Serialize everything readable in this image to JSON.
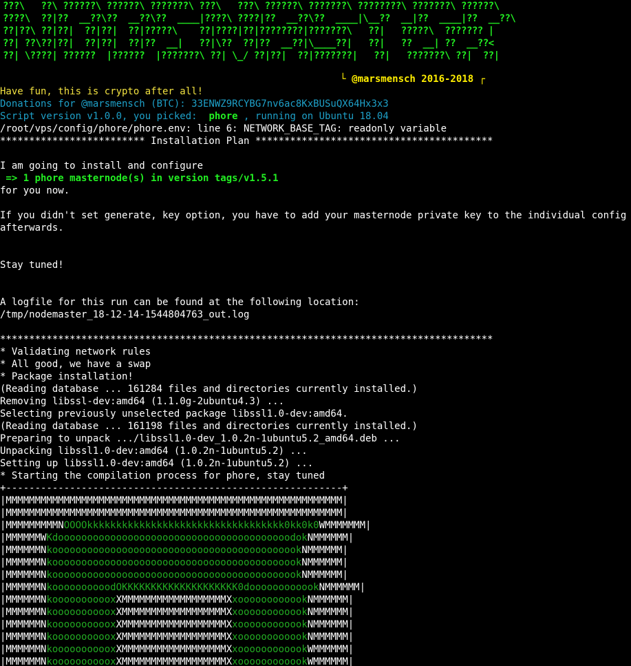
{
  "banner": {
    "lines": [
      "???\\   ??\\ ??????\\ ??????\\ ???????\\ ???\\   ???\\ ??????\\ ???????\\ ????????\\ ???????\\ ??????\\",
      "????\\  ??|??  __??\\??  __??\\??  ____|????\\ ????|??  __??\\??  ____|\\__??  __|??  ____|??  __??\\",
      "??|??\\ ??|??|  ??|??|  ??|?????\\    ??|????|??|????????|???????\\   ??|   ?????\\  ??????? |",
      "??| ??\\??|??|  ??|??|  ??|??  __|   ??|\\??  ??|??  __??|\\____??|   ??|   ??  __| ??  __??<",
      "??| \\????| ??????  |??????  |???????\\ ??| \\_/ ??|??|  ??|???????|   ??|   ???????\\ ??|  ??|"
    ],
    "credit": "└ @marsmensch 2016-2018 ┌"
  },
  "log": {
    "fun_line": "Have fun, this is crypto after all!",
    "donations": "Donations for @marsmensch (BTC): 33ENWZ9RCYBG7nv6ac8KxBUSuQX64Hx3x3",
    "script_prefix": "Script version v1.0.0, you picked: ",
    "script_coin": " phore ",
    "script_suffix": ", running on Ubuntu 18.04",
    "env_error": "/root/vps/config/phore/phore.env: line 6: NETWORK_BASE_TAG: readonly variable",
    "plan_header": "************************* Installation Plan *****************************************",
    "install_intro": "I am going to install and configure",
    "install_target": " => 1 phore masternode(s) in version tags/v1.5.1",
    "for_you": "for you now.",
    "genkey_note": "If you didn't set generate, key option, you have to add your masternode private key to the individual config files",
    "afterwards": "afterwards.",
    "stay_tuned": "Stay tuned!",
    "logfile_intro": "A logfile for this run can be found at the following location:",
    "logfile_path": "/tmp/nodemaster_18-12-14-1544804763_out.log",
    "stars": "*************************************************************************************",
    "validating": "* Validating network rules",
    "swap": "* All good, we have a swap",
    "pkg_install": "* Package installation!",
    "reading_db_1": "(Reading database ... 161284 files and directories currently installed.)",
    "removing": "Removing libssl-dev:amd64 (1.1.0g-2ubuntu4.3) ...",
    "selecting": "Selecting previously unselected package libssl1.0-dev:amd64.",
    "reading_db_2": "(Reading database ... 161198 files and directories currently installed.)",
    "preparing": "Preparing to unpack .../libssl1.0-dev_1.0.2n-1ubuntu5.2_amd64.deb ...",
    "unpacking": "Unpacking libssl1.0-dev:amd64 (1.0.2n-1ubuntu5.2) ...",
    "setting_up": "Setting up libssl1.0-dev:amd64 (1.0.2n-1ubuntu5.2) ...",
    "compilation": "* Starting the compilation process for phore, stay tuned",
    "box_top": "+----------------------------------------------------------+"
  },
  "logo_rows": [
    {
      "l": "|MMMMMMMMMMMMMMMMMMMMMMMMMMMMMMMMMMMMMMMMMMMMMMMMMMMMMMMMMM|",
      "g": "",
      "r": ""
    },
    {
      "l": "|MMMMMMMMMMMMMMMMMMMMMMMMMMMMMMMMMMMMMMMMMMMMMMMMMMMMMMMMMM|",
      "g": "",
      "r": ""
    },
    {
      "l": "|MMMMMMMMMN",
      "g": "OOOOkkkkkkkkkkkkkkkkkkkkkkkkkkkkkkkkkk0kk0k0",
      "r": "WMMMMMMM|"
    },
    {
      "l": "|MMMMMMW",
      "g": "Kdoooooooooooooooooooooooooooooooooooooooodok",
      "r": "NMMMMMM|"
    },
    {
      "l": "|MMMMMMN",
      "g": "kooooooooooooooooooooooooooooooooooooooooook",
      "r": "NMMMMMM|"
    },
    {
      "l": "|MMMMMMN",
      "g": "kooooooooooooooooooooooooooooooooooooooooook",
      "r": "NMMMMMM|"
    },
    {
      "l": "|MMMMMMN",
      "g": "kooooooooooooooooooooooooooooooooooooooooook",
      "r": "NMMMMMM|"
    },
    {
      "l": "|MMMMMMN",
      "g": "koooooooooodOKKKKKKKKKKKKKKKKKKKK0doooooooooook",
      "r": "NMMMMMM|"
    },
    {
      "l": "|MMMMMMN",
      "g": "koooooooooox",
      "r": "XMMMMMMMMMMMMMMMMMMX",
      "g2": "xoooooooooook",
      "r2": "NMMMMMM|"
    },
    {
      "l": "|MMMMMMN",
      "g": "koooooooooox",
      "r": "XMMMMMMMMMMMMMMMMMMX",
      "g2": "xoooooooooook",
      "r2": "NMMMMMM|"
    },
    {
      "l": "|MMMMMMN",
      "g": "koooooooooox",
      "r": "XMMMMMMMMMMMMMMMMMMX",
      "g2": "xoooooooooook",
      "r2": "NMMMMMM|"
    },
    {
      "l": "|MMMMMMN",
      "g": "koooooooooox",
      "r": "XMMMMMMMMMMMMMMMMMMX",
      "g2": "xoooooooooook",
      "r2": "NMMMMMM|"
    },
    {
      "l": "|MMMMMMN",
      "g": "koooooooooox",
      "r": "XMMMMMMMMMMMMMMMMMMX",
      "g2": "xoooooooooook",
      "r2": "WMMMMMM|"
    },
    {
      "l": "|MMMMMMN",
      "g": "koooooooooox",
      "r": "XMMMMMMMMMMMMMMMMMMX",
      "g2": "xoooooooooook",
      "r2": "WMMMMMM|"
    }
  ]
}
